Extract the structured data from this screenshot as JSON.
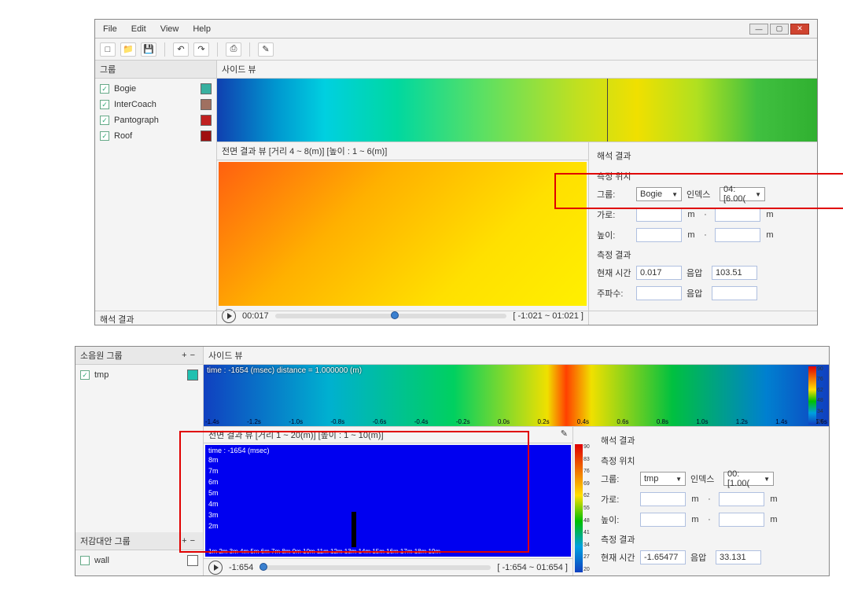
{
  "menu": {
    "file": "File",
    "edit": "Edit",
    "view": "View",
    "help": "Help"
  },
  "toolbar": {
    "new": "□",
    "open": "📁",
    "save": "💾",
    "undo": "↶",
    "redo": "↷",
    "print": "⎙",
    "settings": "✎"
  },
  "left1": {
    "title": "그룹",
    "items": [
      {
        "label": "Bogie",
        "color": "#38b0a0"
      },
      {
        "label": "InterCoach",
        "color": "#a07060"
      },
      {
        "label": "Pantograph",
        "color": "#c02020"
      },
      {
        "label": "Roof",
        "color": "#a01010"
      }
    ]
  },
  "sideview_title": "사이드 뷰",
  "frontview_title": "전면 결과 뷰 [거리 4 ~ 8(m)] [높이 : 1 ~ 6(m)]",
  "player": {
    "time": "00:017",
    "range": "[ -1:021 ~ 01:021 ]"
  },
  "results1": {
    "title": "해석 결과",
    "pos_sec": "측정 위치",
    "group_lbl": "그룹:",
    "group_val": "Bogie",
    "index_lbl": "인덱스",
    "index_val": "04:[6.00(",
    "h_lbl": "가로:",
    "v_lbl": "높이:",
    "unit": "m",
    "tilde": "·",
    "res_sec": "측정 결과",
    "time_lbl": "현재 시간",
    "time_val": "0.017",
    "sp_lbl": "음압",
    "sp_val": "103.51",
    "freq_lbl": "주파수:"
  },
  "bottom1": "해석 결과",
  "w2": {
    "left_title": "소음원 그룹",
    "group": {
      "label": "tmp",
      "color": "#20c0b0"
    },
    "reduce_title": "저감대안 그룹",
    "reduce_item": "wall",
    "sideview_title": "사이드 뷰",
    "time_overlay": "time : -1654 (msec)  distance = 1.000000 (m)",
    "timeticks": [
      "-1.4s",
      "-1.2s",
      "-1.0s",
      "-0.8s",
      "-0.6s",
      "-0.4s",
      "-0.2s",
      "0.0s",
      "0.2s",
      "0.4s",
      "0.6s",
      "0.8s",
      "1.0s",
      "1.2s",
      "1.4s",
      "1.6s"
    ],
    "cb": [
      "90",
      "76",
      "62",
      "48",
      "34",
      "20"
    ],
    "front_title": "전면 결과 뷰 [거리 1 ~ 20(m)] [높이 : 1 ~ 10(m)]",
    "front_time": "time : -1654 (msec)",
    "yticks": [
      "8m",
      "7m",
      "6m",
      "5m",
      "4m",
      "3m",
      "2m"
    ],
    "xticks": "1m  2m  3m  4m  5m  6m  7m  8m  9m  10m 11m 12m 13m 14m 15m 16m 17m 18m 19m",
    "player_time": "-1:654",
    "player_range": "[ -1:654 ~ 01:654 ]",
    "cb2": [
      "90",
      "83",
      "76",
      "69",
      "62",
      "55",
      "48",
      "41",
      "34",
      "27",
      "20"
    ],
    "results": {
      "title": "해석 결과",
      "pos_sec": "측정 위치",
      "group_lbl": "그룹:",
      "group_val": "tmp",
      "index_lbl": "인덱스",
      "index_val": "00:[1.00(",
      "h_lbl": "가로:",
      "v_lbl": "높이:",
      "unit": "m",
      "tilde": "·",
      "res_sec": "측정 결과",
      "time_lbl": "현재 시간",
      "time_val": "-1.65477",
      "sp_lbl": "음압",
      "sp_val": "33.131"
    }
  }
}
